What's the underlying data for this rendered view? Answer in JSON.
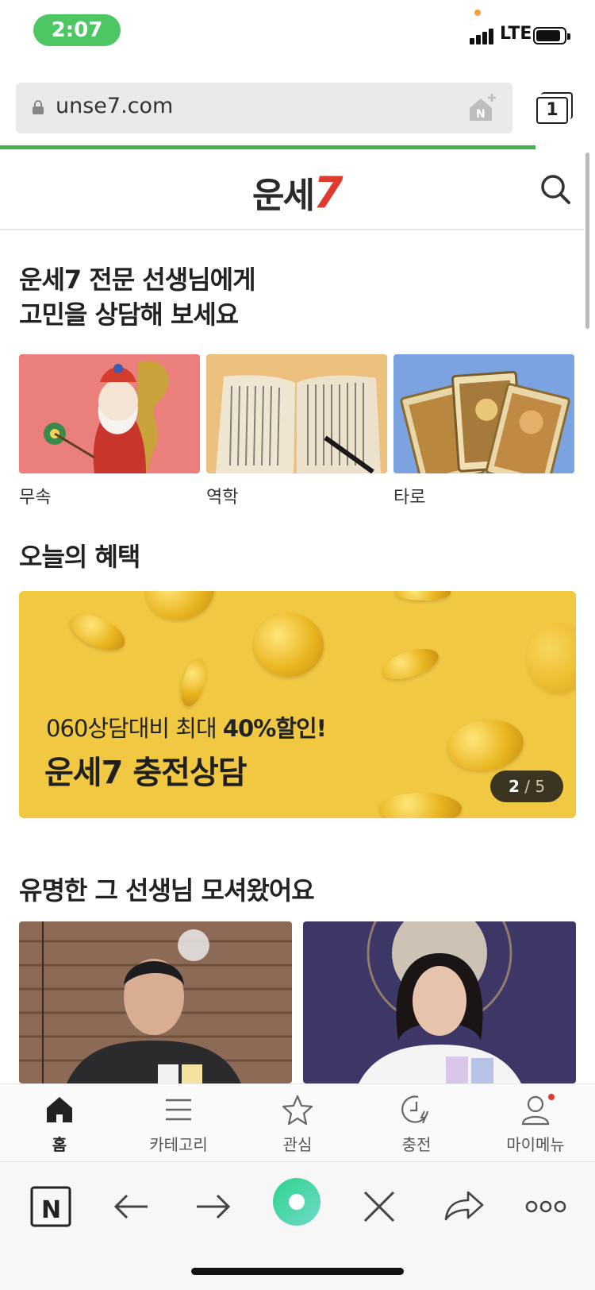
{
  "status": {
    "time": "2:07",
    "network": "LTE"
  },
  "browser": {
    "url": "unse7.com",
    "tab_count": "1",
    "page_load_progress": 0.9
  },
  "site": {
    "logo_text": "운세",
    "logo_seven": "7"
  },
  "expert_section": {
    "title_line1": "운세7 전문 선생님에게",
    "title_line2": "고민을 상담해 보세요",
    "categories": [
      {
        "label": "무속",
        "icon": "shaman-figure-image"
      },
      {
        "label": "역학",
        "icon": "old-book-image"
      },
      {
        "label": "타로",
        "icon": "tarot-cards-image"
      }
    ]
  },
  "benefit_section": {
    "title": "오늘의 혜택",
    "banner": {
      "subtitle_prefix": "060상담대비 최대 ",
      "subtitle_bold": "40%할인!",
      "title": "운세7 충전상담",
      "page_current": "2",
      "page_sep": " / ",
      "page_total": "5"
    }
  },
  "famous_section": {
    "title": "유명한 그 선생님 모셔왔어요"
  },
  "site_nav": [
    {
      "label": "홈",
      "icon": "home-icon",
      "active": true
    },
    {
      "label": "카테고리",
      "icon": "menu-icon",
      "active": false
    },
    {
      "label": "관심",
      "icon": "star-icon",
      "active": false
    },
    {
      "label": "충전",
      "icon": "charge-clock-icon",
      "active": false
    },
    {
      "label": "마이메뉴",
      "icon": "profile-icon",
      "active": false
    }
  ],
  "browser_bar": [
    "naver-icon",
    "back-arrow-icon",
    "forward-arrow-icon",
    "green-dot-icon",
    "close-icon",
    "share-icon",
    "more-icon"
  ],
  "colors": {
    "accent_green": "#4cc764",
    "brand_red": "#e03a2e",
    "banner_yellow": "#f1c842"
  }
}
